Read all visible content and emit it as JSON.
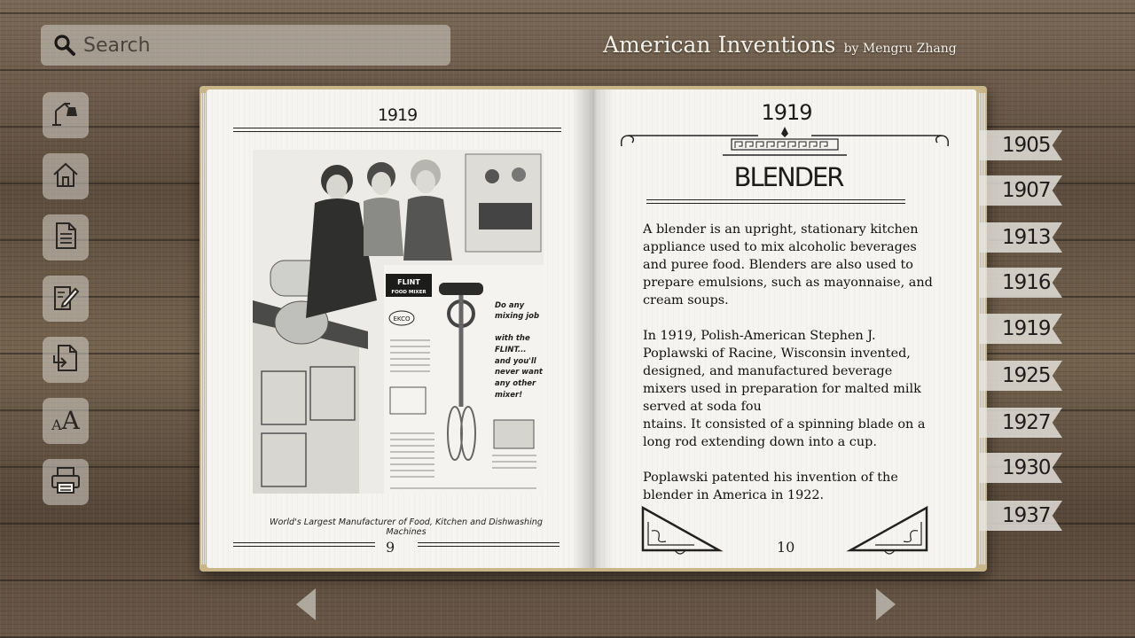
{
  "search": {
    "placeholder": "Search"
  },
  "header": {
    "title": "American Inventions",
    "byline": "by Mengru Zhang"
  },
  "toolbar": {
    "items": [
      {
        "name": "bell-icon"
      },
      {
        "name": "home-icon"
      },
      {
        "name": "document-icon"
      },
      {
        "name": "edit-icon"
      },
      {
        "name": "download-icon"
      },
      {
        "name": "font-size-icon",
        "glyph_small": "A",
        "glyph_large": "A"
      },
      {
        "name": "print-icon"
      }
    ]
  },
  "book": {
    "left_page": {
      "year": "1919",
      "caption": "World's Largest Manufacturer of Food, Kitchen and Dishwashing Machines",
      "ad": {
        "brand": "FLINT",
        "brand_sub": "FOOD MIXER",
        "maker": "EKCO",
        "slogan": [
          "Do any",
          "mixing job",
          "with the",
          "FLINT...",
          "and you'll",
          "never want",
          "any other",
          "mixer!"
        ]
      },
      "page_number": "9"
    },
    "right_page": {
      "year": "1919",
      "heading": "BLENDER",
      "paragraphs": [
        "A blender is an upright, stationary kitchen appliance used to mix alcoholic beverages and puree food. Blenders are also used to prepare emulsions, such as mayonnaise, and cream soups.",
        "In 1919, Polish-American Stephen J. Poplawski of Racine, Wisconsin invented, designed, and manufactured beverage mixers used in preparation for malted milk served at soda fou\nntains. It consisted of a spinning blade on a long rod extending down into a cup.",
        "Poplawski patented his invention of the blender in America in 1922."
      ],
      "page_number": "10"
    }
  },
  "year_tabs": [
    "1905",
    "1907",
    "1913",
    "1916",
    "1919",
    "1925",
    "1927",
    "1930",
    "1937"
  ],
  "nav": {
    "prev": "previous-page",
    "next": "next-page"
  },
  "colors": {
    "ink": "#1e1c1a",
    "paper": "#f5f4f0",
    "book_cover": "#c9b688",
    "tab": "#e6e4de"
  }
}
